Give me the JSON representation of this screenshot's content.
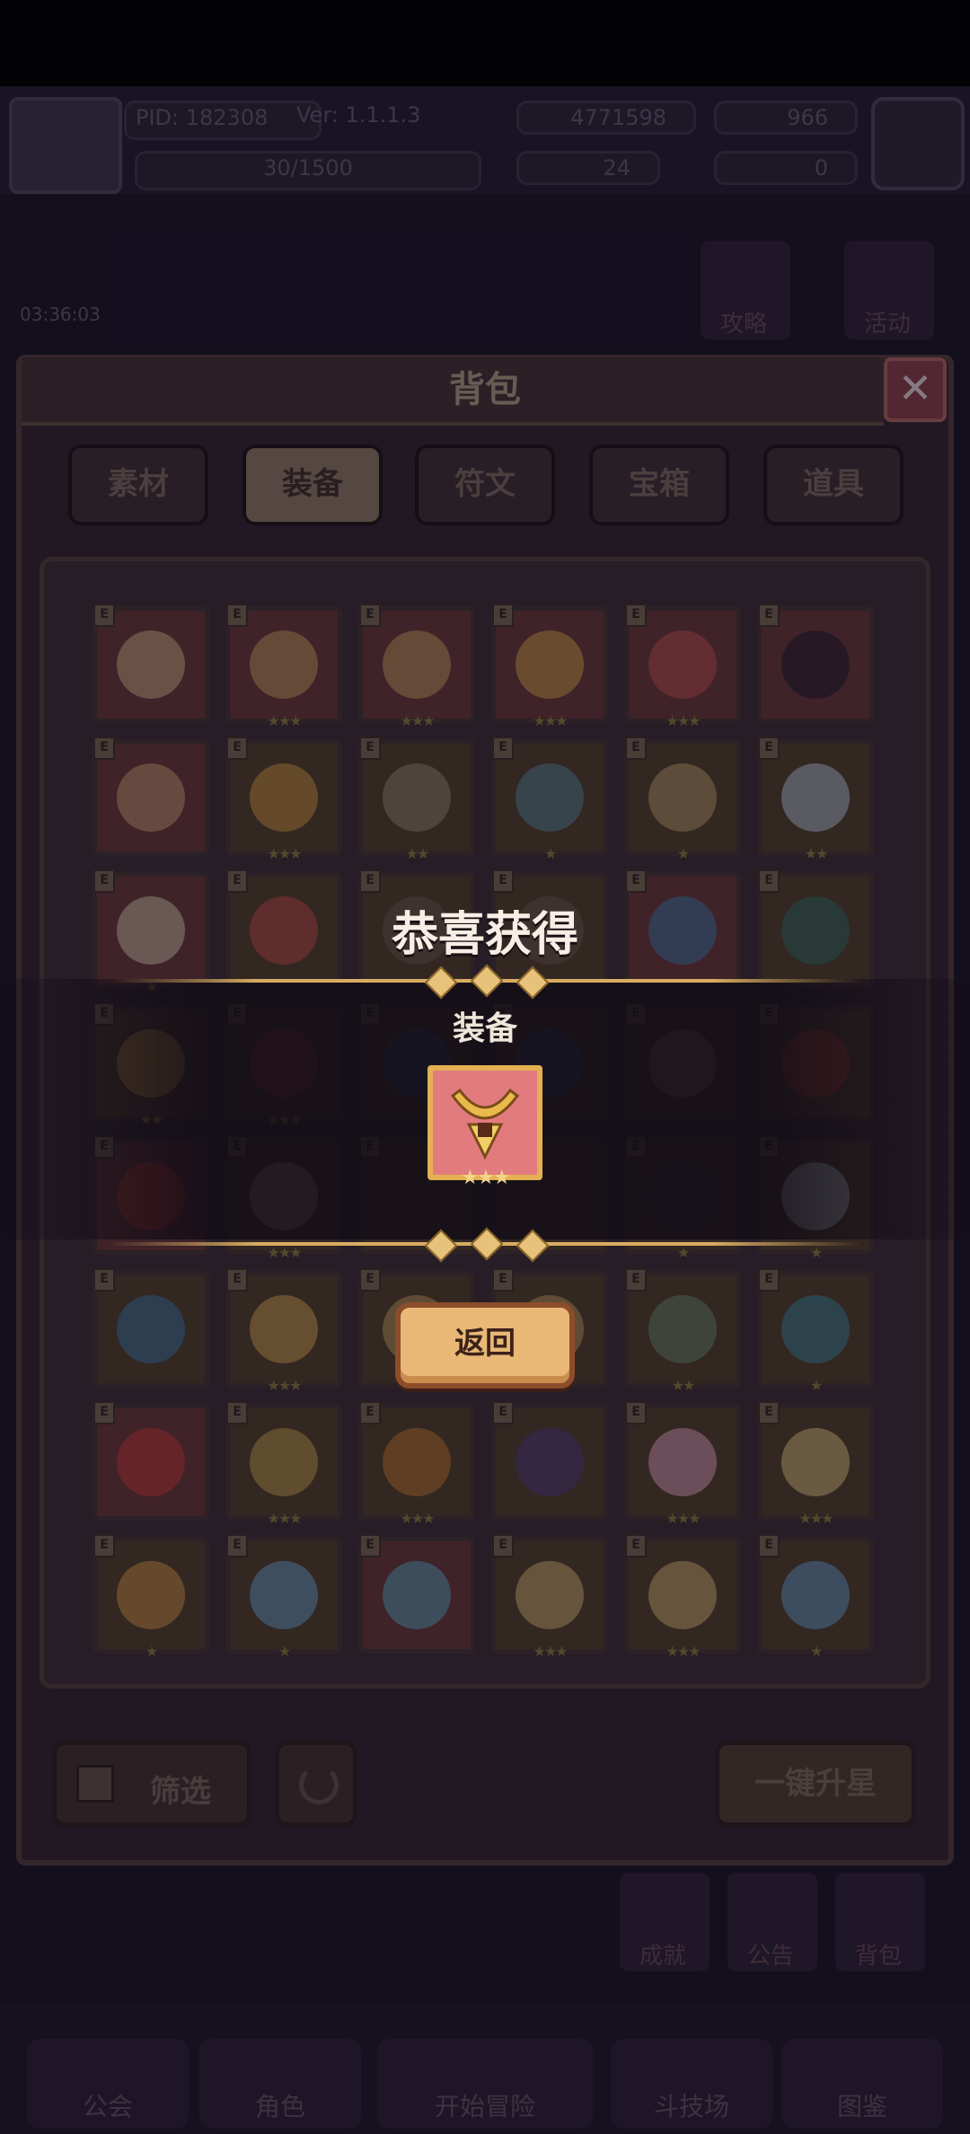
{
  "status_bar": {},
  "header": {
    "pid": "PID: 182308",
    "version": "Ver: 1.1.1.3",
    "energy": "30/1500",
    "gold": "4771598",
    "gems": "966",
    "currency3": "24",
    "currency4": "0"
  },
  "scene": {
    "timer": "03:36:03",
    "guide_label": "攻略",
    "event_label": "活动",
    "achievement_label": "成就",
    "notice_label": "公告",
    "bag_label": "背包"
  },
  "bottom_nav": {
    "items": [
      "公会",
      "角色",
      "开始冒险",
      "斗技场",
      "图鉴"
    ]
  },
  "panel": {
    "title": "背包",
    "close_symbol": "✕",
    "tabs": [
      {
        "label": "素材",
        "active": false
      },
      {
        "label": "装备",
        "active": true
      },
      {
        "label": "符文",
        "active": false
      },
      {
        "label": "宝箱",
        "active": false
      },
      {
        "label": "道具",
        "active": false
      }
    ],
    "badge_letter": "E",
    "filter_label": "筛选",
    "upgrade_all_label": "一键升星"
  },
  "grid": [
    [
      {
        "bg": "r",
        "stars": 0,
        "icon": "staff-icon",
        "c": "#d9b08a"
      },
      {
        "bg": "r",
        "stars": 3,
        "icon": "hat-icon",
        "c": "#c9a063"
      },
      {
        "bg": "r",
        "stars": 3,
        "icon": "crown-icon",
        "c": "#c9a063"
      },
      {
        "bg": "r",
        "stars": 3,
        "icon": "necklace-icon",
        "c": "#d4a54e"
      },
      {
        "bg": "r",
        "stars": 3,
        "icon": "helmet-icon",
        "c": "#c25050"
      },
      {
        "bg": "r",
        "stars": 0,
        "icon": "orb-icon",
        "c": "#1c1630"
      }
    ],
    [
      {
        "bg": "r",
        "stars": 0,
        "icon": "ring-icon",
        "c": "#caa07a"
      },
      {
        "bg": "g",
        "stars": 3,
        "icon": "mace-icon",
        "c": "#d49a45"
      },
      {
        "bg": "g",
        "stars": 2,
        "icon": "axe-icon",
        "c": "#9a8a7a"
      },
      {
        "bg": "g",
        "stars": 1,
        "icon": "spiked-mace-icon",
        "c": "#5a8aa0"
      },
      {
        "bg": "g",
        "stars": 1,
        "icon": "bow-icon",
        "c": "#c0a070"
      },
      {
        "bg": "g",
        "stars": 2,
        "icon": "crystal-ball-icon",
        "c": "#b8c8e0"
      }
    ],
    [
      {
        "bg": "r",
        "stars": 1,
        "icon": "bone-staff-icon",
        "c": "#d7c7b5"
      },
      {
        "bg": "g",
        "stars": 0,
        "icon": "robe-icon",
        "c": "#c24848"
      },
      {
        "bg": "g",
        "stars": 0,
        "icon": "armor-icon",
        "c": "#6a5a50"
      },
      {
        "bg": "g",
        "stars": 0,
        "icon": "armor-icon",
        "c": "#6a5a50"
      },
      {
        "bg": "r",
        "stars": 0,
        "icon": "hood-icon",
        "c": "#3a78b0"
      },
      {
        "bg": "g",
        "stars": 0,
        "icon": "helm-icon",
        "c": "#2f6b6b"
      }
    ],
    [
      {
        "bg": "g",
        "stars": 2,
        "icon": "pauldron-icon",
        "c": "#d09a4a"
      },
      {
        "bg": "g",
        "stars": 3,
        "icon": "chestplate-icon",
        "c": "#b04040"
      },
      {
        "bg": "g",
        "stars": 0,
        "icon": "armor-icon",
        "c": "#3a5a88"
      },
      {
        "bg": "g",
        "stars": 0,
        "icon": "armor-icon",
        "c": "#3a5a88"
      },
      {
        "bg": "g",
        "stars": 0,
        "icon": "vest-icon",
        "c": "#8a7a70"
      },
      {
        "bg": "g",
        "stars": 0,
        "icon": "boots-icon",
        "c": "#b03838"
      }
    ],
    [
      {
        "bg": "r",
        "stars": 0,
        "icon": "armor-icon",
        "c": "#c04030"
      },
      {
        "bg": "g",
        "stars": 3,
        "icon": "bone-icon",
        "c": "#c8a888"
      },
      {
        "bg": "g",
        "stars": 0,
        "icon": "armor-icon",
        "c": "#5a3a3a"
      },
      {
        "bg": "g",
        "stars": 0,
        "icon": "armor-icon",
        "c": "#5a3a3a"
      },
      {
        "bg": "g",
        "stars": 1,
        "icon": "armor-icon",
        "c": "#2a3a58"
      },
      {
        "bg": "g",
        "stars": 1,
        "icon": "mask-icon",
        "c": "#c8d8e8"
      }
    ],
    [
      {
        "bg": "g",
        "stars": 0,
        "icon": "gauntlet-icon",
        "c": "#3a78b0"
      },
      {
        "bg": "g",
        "stars": 3,
        "icon": "amulet-icon",
        "c": "#d8a858"
      },
      {
        "bg": "g",
        "stars": 3,
        "icon": "ring-icon",
        "c": "#c8a060"
      },
      {
        "bg": "g",
        "stars": 3,
        "icon": "ring-icon",
        "c": "#c8a060"
      },
      {
        "bg": "g",
        "stars": 2,
        "icon": "ring-icon",
        "c": "#6a8a70"
      },
      {
        "bg": "g",
        "stars": 1,
        "icon": "bracer-icon",
        "c": "#3a88a0"
      }
    ],
    [
      {
        "bg": "r",
        "stars": 0,
        "icon": "gloves-icon",
        "c": "#c83838"
      },
      {
        "bg": "g",
        "stars": 3,
        "icon": "boots-icon",
        "c": "#c8a050"
      },
      {
        "bg": "g",
        "stars": 3,
        "icon": "boots-icon",
        "c": "#c87a30"
      },
      {
        "bg": "g",
        "stars": 0,
        "icon": "boots-icon",
        "c": "#4a3a88"
      },
      {
        "bg": "g",
        "stars": 3,
        "icon": "heart-pendant-icon",
        "c": "#e8a8c8"
      },
      {
        "bg": "g",
        "stars": 3,
        "icon": "gem-pendant-icon",
        "c": "#e8c888"
      }
    ],
    [
      {
        "bg": "g",
        "stars": 1,
        "icon": "gem-cluster-icon",
        "c": "#d89848"
      },
      {
        "bg": "g",
        "stars": 1,
        "icon": "ice-gem-icon",
        "c": "#6aa8d8"
      },
      {
        "bg": "r",
        "stars": 0,
        "icon": "rose-gem-icon",
        "c": "#5aa8c8"
      },
      {
        "bg": "g",
        "stars": 3,
        "icon": "necklace-icon",
        "c": "#d8b878"
      },
      {
        "bg": "g",
        "stars": 3,
        "icon": "necklace-icon",
        "c": "#d8b878"
      },
      {
        "bg": "g",
        "stars": 1,
        "icon": "frost-necklace-icon",
        "c": "#6aa0d8"
      }
    ]
  ],
  "popup": {
    "title": "恭喜获得",
    "category": "装备",
    "reward_stars": "★★★",
    "reward_icon": "golden-necklace-icon",
    "back_label": "返回"
  }
}
